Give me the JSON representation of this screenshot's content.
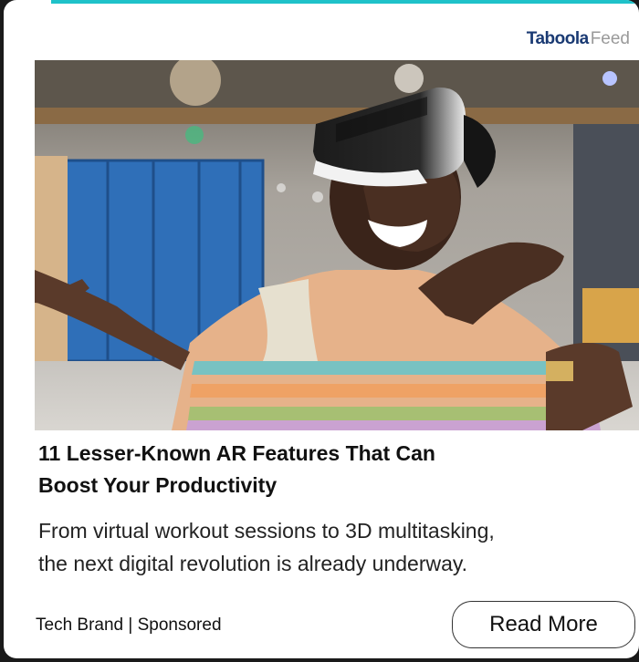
{
  "brand": {
    "name": "Taboola",
    "suffix": "Feed"
  },
  "ad": {
    "headline_line1": "11 Lesser-Known AR Features That Can",
    "headline_line2": "Boost Your Productivity",
    "description_line1": "From virtual workout sessions to 3D multitasking,",
    "description_line2": "the next digital revolution is already underway.",
    "byline": "Tech Brand | Sponsored",
    "cta_label": "Read More"
  },
  "colors": {
    "accent": "#1fc2c9",
    "brand_name": "#1a3a73",
    "brand_suffix": "#9a9a9a"
  },
  "image": {
    "alt_subject": "person-wearing-vr-headset"
  }
}
